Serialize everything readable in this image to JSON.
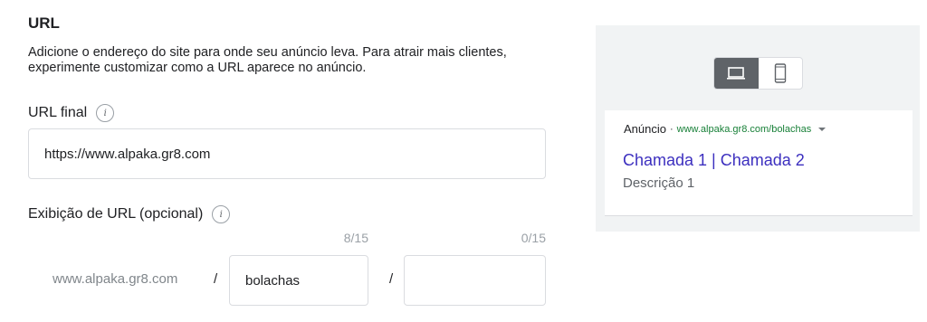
{
  "section": {
    "title": "URL",
    "description": "Adicione o endereço do site para onde seu anúncio leva. Para atrair mais clientes, experimente customizar como a URL aparece no anúncio."
  },
  "final_url": {
    "label": "URL final",
    "value": "https://www.alpaka.gr8.com"
  },
  "display_url": {
    "label": "Exibição de URL (opcional)",
    "domain": "www.alpaka.gr8.com",
    "separator": "/",
    "path1": {
      "value": "bolachas",
      "counter": "8/15"
    },
    "path2": {
      "value": "",
      "counter": "0/15"
    }
  },
  "preview": {
    "ad_label": "Anúncio",
    "dot": "·",
    "ad_url": "www.alpaka.gr8.com/bolachas",
    "headline": "Chamada 1 | Chamada 2",
    "description": "Descrição 1",
    "devices": [
      "desktop-icon",
      "mobile-icon"
    ],
    "active_device": "desktop"
  },
  "icons": {
    "info": "i"
  },
  "colors": {
    "headline": "#3c2fbf",
    "ad_url": "#188038",
    "toggle_active": "#5f6368"
  }
}
